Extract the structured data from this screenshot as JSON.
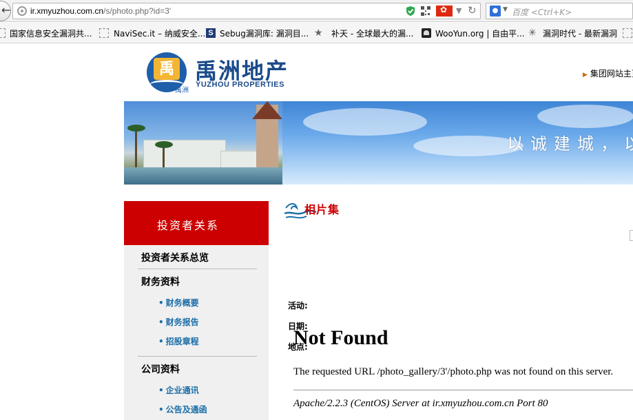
{
  "browser": {
    "url_host": "ir.xmyuzhou.com.cn",
    "url_path": "/s/photo.php?id=3'",
    "search_placeholder": "百度 <Ctrl+K>",
    "search_engine_icon": "baidu-paw-icon"
  },
  "bookmarks": [
    {
      "label": "国家信息安全漏洞共...",
      "icon": "folder-icon"
    },
    {
      "label": "NaviSec.it – 纳威安全...",
      "icon": "page-icon"
    },
    {
      "label": "Sebug漏洞库: 漏洞目...",
      "icon": "sebug-icon"
    },
    {
      "label": "补天 - 全球最大的漏...",
      "icon": "star-icon"
    },
    {
      "label": "WooYun.org | 自由平...",
      "icon": "wooyun-icon"
    },
    {
      "label": "漏洞时代 - 最新漏洞",
      "icon": "spider-icon"
    }
  ],
  "header": {
    "logo_char": "禹",
    "logo_small": "禹洲",
    "brand_cn": "禹洲地产",
    "brand_en": "YUZHOU PROPERTIES",
    "group_link": "集团网站主页"
  },
  "banner": {
    "slogan": "以诚建城，以"
  },
  "sidebar": {
    "title": "投资者关系",
    "overview": "投资者关系总览",
    "financial_heading": "财务资料",
    "financial_items": [
      "财务概要",
      "财务报告",
      "招股章程"
    ],
    "company_heading": "公司资料",
    "company_items": [
      "企业通讯",
      "公告及通函"
    ]
  },
  "content": {
    "title": "相片集",
    "fields": [
      "活动:",
      "日期:",
      "地点:"
    ],
    "not_found_title": "Not Found",
    "not_found_text": "The requested URL /photo_gallery/3'/photo.php was not found on this server.",
    "server_address": "Apache/2.2.3 (CentOS) Server at ir.xmyuzhou.com.cn Port 80"
  },
  "colors": {
    "accent_red": "#cc0000",
    "brand_blue": "#1a4a8a",
    "link_blue": "#1b6ea8"
  }
}
